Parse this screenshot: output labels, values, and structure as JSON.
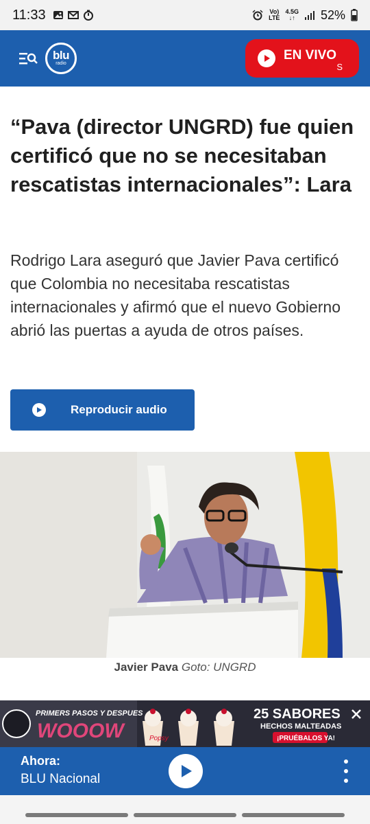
{
  "status_bar": {
    "time": "11:33",
    "net_top": "Vo)",
    "net_bottom": "LTE",
    "gen": "4.5G",
    "battery": "52%",
    "left_icons": [
      "gallery-icon",
      "gmail-icon",
      "timer-icon"
    ],
    "right_icons": [
      "alarm-icon",
      "signal-icon",
      "battery-icon"
    ]
  },
  "header": {
    "logo_text": "blu",
    "logo_sub": "radio",
    "live_label": "EN VIVO",
    "live_sub": "S",
    "colors": {
      "brand_blue": "#1d5fae",
      "live_red": "#e3121b"
    }
  },
  "article": {
    "title": "“Pava (director UNGRD) fue quien certificó que no se necesitaban rescatistas internacionales”: Lara",
    "lead": "Rodrigo Lara aseguró que Javier Pava certificó que Colombia no necesitaba rescatistas internacionales y afirmó que el nuevo Gobierno abrió las puertas a ayuda de otros países.",
    "audio_button": "Reproducir audio"
  },
  "photo": {
    "caption_name": "Javier Pava",
    "caption_credit": "Goto: UNGRD"
  },
  "ad": {
    "left_text": "PRIMERS PASOS Y DESPUES",
    "big_text": "WOOOW",
    "brand": "Popsy",
    "right_title": "25 SABORES",
    "right_sub": "HECHOS MALTEADAS",
    "right_cta": "¡PRUÉBALOS YA!"
  },
  "player": {
    "now_label": "Ahora:",
    "station": "BLU Nacional"
  }
}
